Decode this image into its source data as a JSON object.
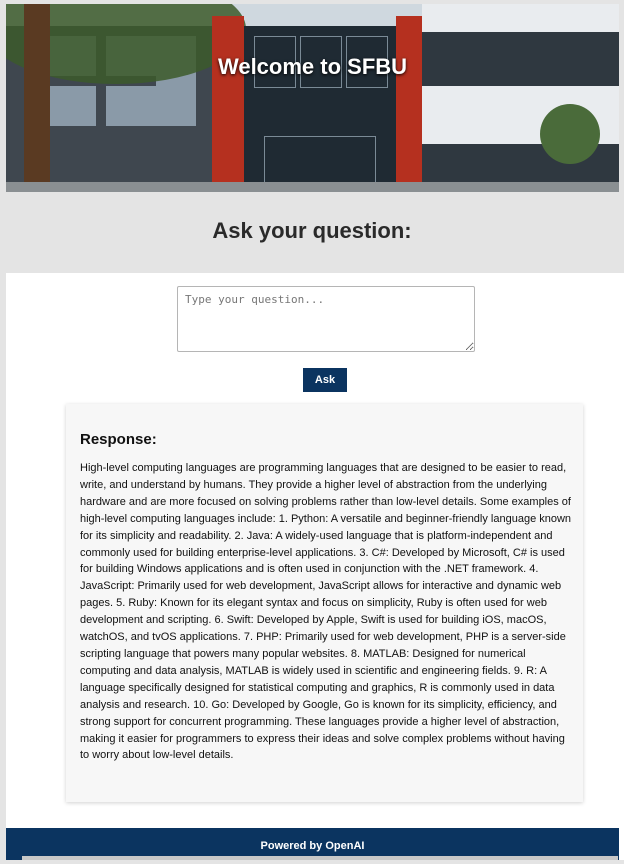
{
  "hero": {
    "title": "Welcome to SFBU"
  },
  "form": {
    "heading": "Ask your question:",
    "question_placeholder": "Type your question...",
    "question_value": "",
    "ask_label": "Ask"
  },
  "response": {
    "title": "Response:",
    "text": "High-level computing languages are programming languages that are designed to be easier to read, write, and understand by humans. They provide a higher level of abstraction from the underlying hardware and are more focused on solving problems rather than low-level details. Some examples of high-level computing languages include: 1. Python: A versatile and beginner-friendly language known for its simplicity and readability. 2. Java: A widely-used language that is platform-independent and commonly used for building enterprise-level applications. 3. C#: Developed by Microsoft, C# is used for building Windows applications and is often used in conjunction with the .NET framework. 4. JavaScript: Primarily used for web development, JavaScript allows for interactive and dynamic web pages. 5. Ruby: Known for its elegant syntax and focus on simplicity, Ruby is often used for web development and scripting. 6. Swift: Developed by Apple, Swift is used for building iOS, macOS, watchOS, and tvOS applications. 7. PHP: Primarily used for web development, PHP is a server-side scripting language that powers many popular websites. 8. MATLAB: Designed for numerical computing and data analysis, MATLAB is widely used in scientific and engineering fields. 9. R: A language specifically designed for statistical computing and graphics, R is commonly used in data analysis and research. 10. Go: Developed by Google, Go is known for its simplicity, efficiency, and strong support for concurrent programming. These languages provide a higher level of abstraction, making it easier for programmers to express their ideas and solve complex problems without having to worry about low-level details."
  },
  "footer": {
    "text": "Powered by OpenAI"
  },
  "colors": {
    "brand_navy": "#0b3460",
    "page_background": "#e4e4e4",
    "card_background": "#f7f7f7"
  }
}
